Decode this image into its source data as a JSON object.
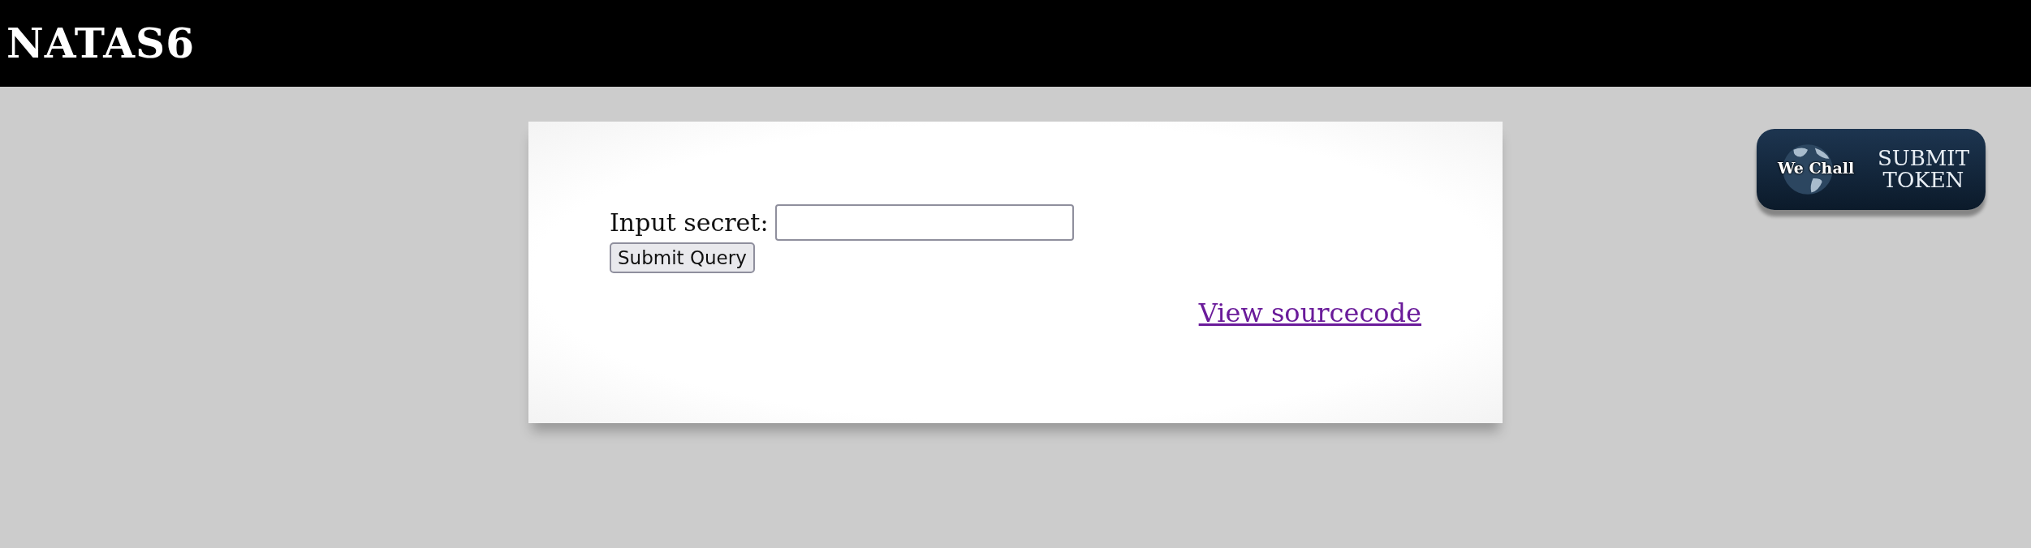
{
  "header": {
    "title": "NATAS6"
  },
  "content": {
    "label": "Input secret:",
    "submit_button": "Submit Query",
    "link": "View sourcecode"
  },
  "wechall_button": {
    "logo_text": "We Chall",
    "caption": [
      "SUBMIT",
      "TOKEN"
    ]
  }
}
